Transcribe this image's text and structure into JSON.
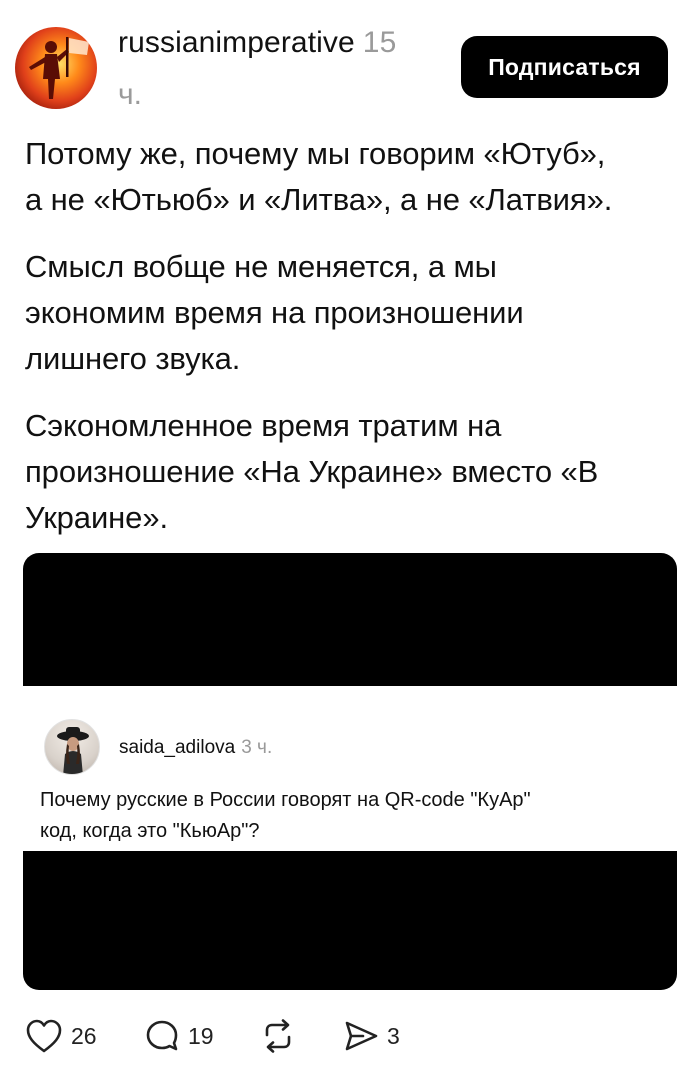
{
  "post": {
    "author": "russianimperative",
    "time_hours": "15",
    "time_unit": "ч.",
    "follow_label": "Подписаться",
    "paragraphs": [
      [
        "Потому же, почему мы говорим «Ютуб»,",
        "а не «Ютьюб» и «Литва», а не «Латвия»."
      ],
      [
        "Смысл вобще не меняется, а мы",
        "экономим время на произношении",
        "лишнего звука."
      ],
      [
        "Сэкономленное время тратим на",
        "произношение «На Украине» вместо «В",
        "Украине»."
      ]
    ]
  },
  "embedded": {
    "author": "saida_adilova",
    "time": "3 ч.",
    "text_lines": [
      "Почему русские в России говорят на QR-code \"КуАр\"",
      "код, когда это \"КьюАр\"?"
    ]
  },
  "actions": {
    "likes": "26",
    "comments": "19",
    "shares": "3"
  },
  "colors": {
    "text": "#111111",
    "muted": "#9a9a9a",
    "button_bg": "#000000",
    "button_text": "#ffffff"
  },
  "icons": [
    "heart-icon",
    "comment-bubble-icon",
    "repost-icon",
    "share-send-icon"
  ]
}
